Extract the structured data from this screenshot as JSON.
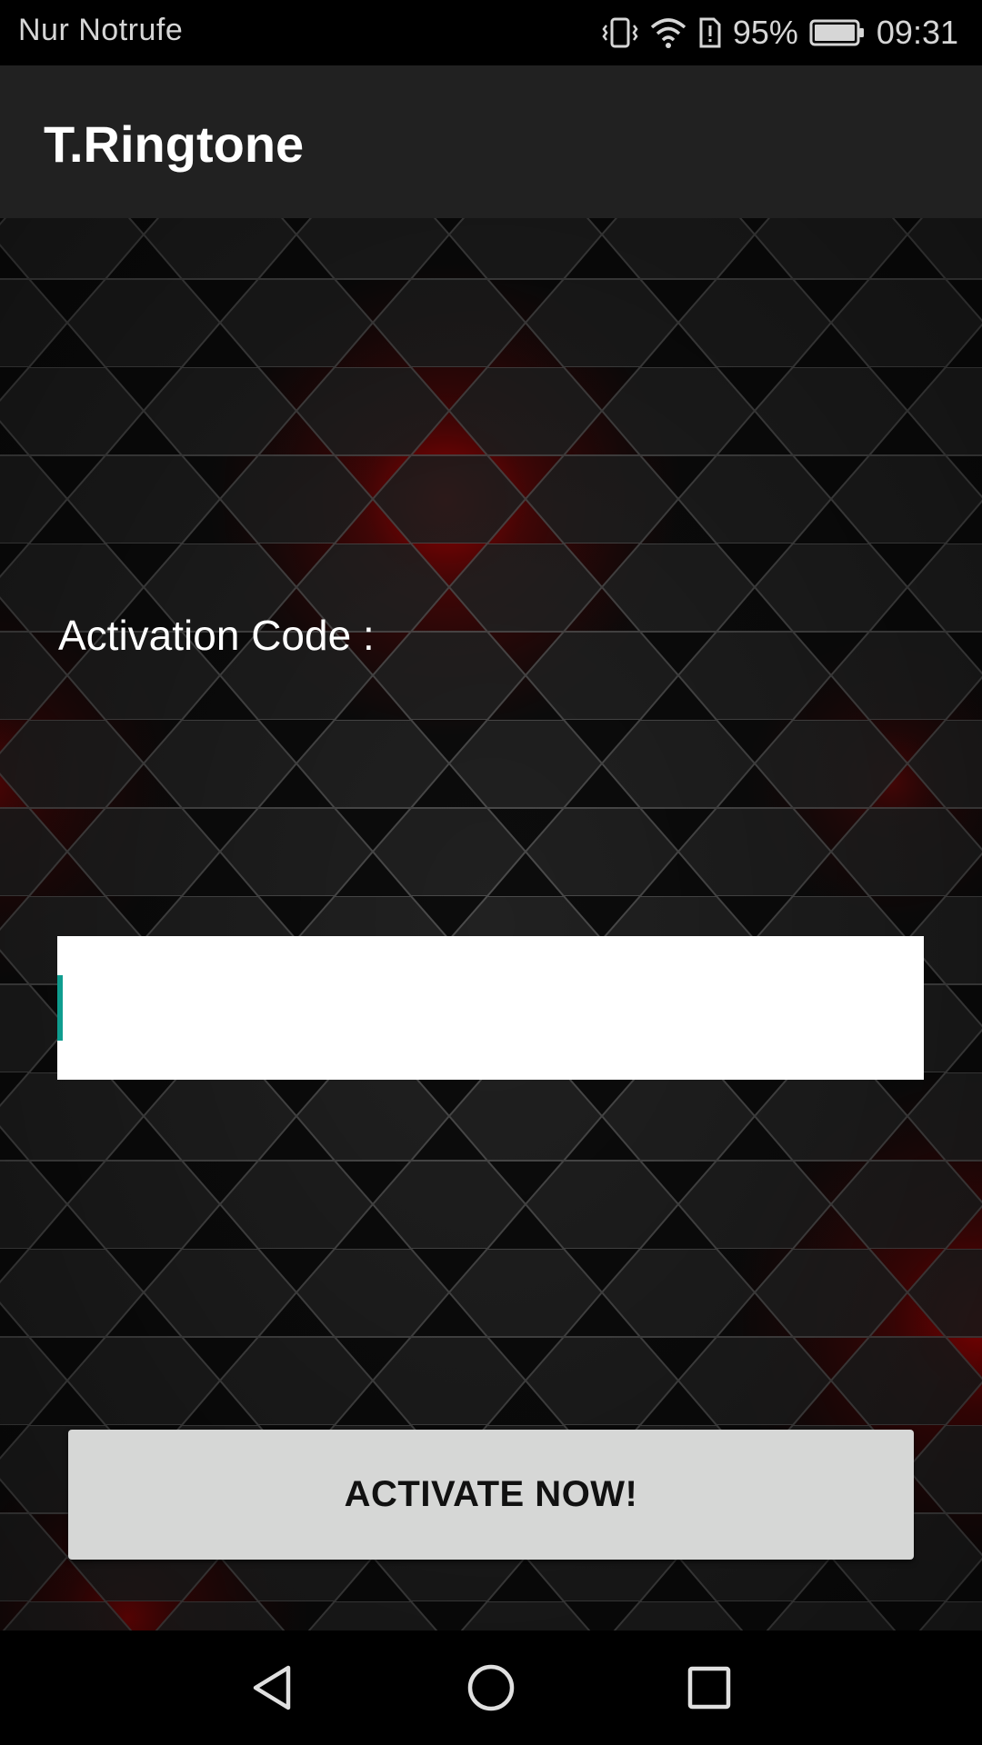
{
  "status_bar": {
    "carrier": "Nur Notrufe",
    "battery_percent": "95%",
    "time": "09:31",
    "icons": [
      "vibrate-icon",
      "wifi-icon",
      "sim-alert-icon",
      "battery-icon"
    ]
  },
  "app_bar": {
    "title": "T.Ringtone"
  },
  "form": {
    "label": "Activation Code :",
    "code_value": "",
    "button_label": "ACTIVATE NOW!"
  },
  "nav_bar": {
    "icons": [
      "back-icon",
      "home-icon",
      "recents-icon"
    ]
  },
  "colors": {
    "app_bar_bg": "#212121",
    "accent_cursor": "#0f9d8f",
    "button_bg": "#d6d7d6",
    "background_glow": "#c00000"
  }
}
